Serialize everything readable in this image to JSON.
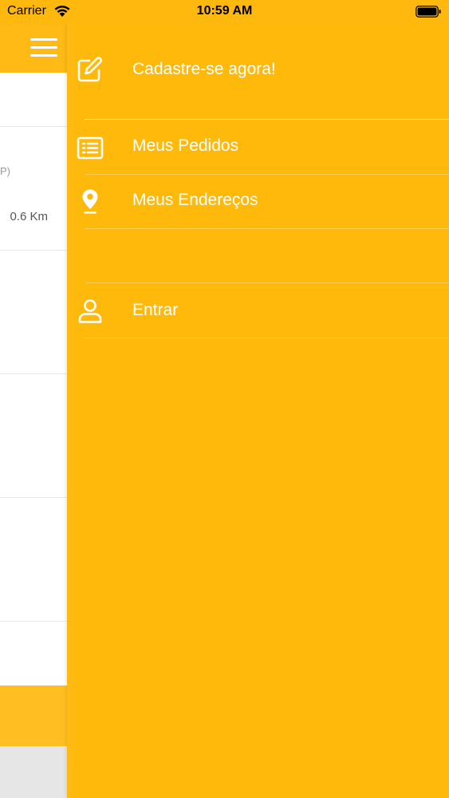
{
  "status_bar": {
    "carrier": "Carrier",
    "time": "10:59 AM"
  },
  "background_screen": {
    "visible_fragment": "P)",
    "distance": "0.6 Km"
  },
  "drawer": {
    "items": [
      {
        "label": "Cadastre-se agora!",
        "icon": "edit-icon"
      },
      {
        "label": "Meus Pedidos",
        "icon": "list-icon"
      },
      {
        "label": "Meus Endereços",
        "icon": "map-pin-icon"
      },
      {
        "label": "Entrar",
        "icon": "user-icon"
      }
    ]
  },
  "colors": {
    "drawer_background": "#FFB90B",
    "header_accent": "#FFBA16",
    "text_on_accent": "#FFFFFF"
  }
}
